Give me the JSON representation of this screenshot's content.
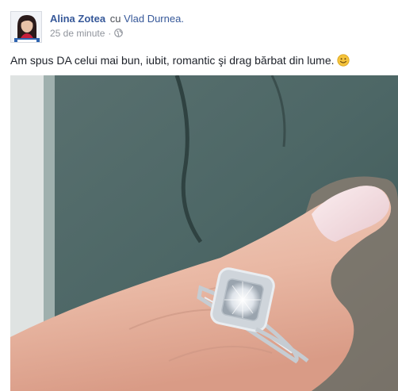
{
  "post": {
    "author": "Alina Zotea",
    "with_word": "cu",
    "tagged": "Vlad Durnea.",
    "timestamp": "25 de minute",
    "separator": "·",
    "privacy_icon": "globe-icon",
    "text": "Am spus DA celui mai bun, iubit, romantic şi drag bărbat din lume.",
    "emoji": "smile-emoji-icon"
  },
  "colors": {
    "link": "#365899",
    "text": "#1d2129",
    "meta": "#90949c",
    "emoji": "#f5c33b"
  }
}
